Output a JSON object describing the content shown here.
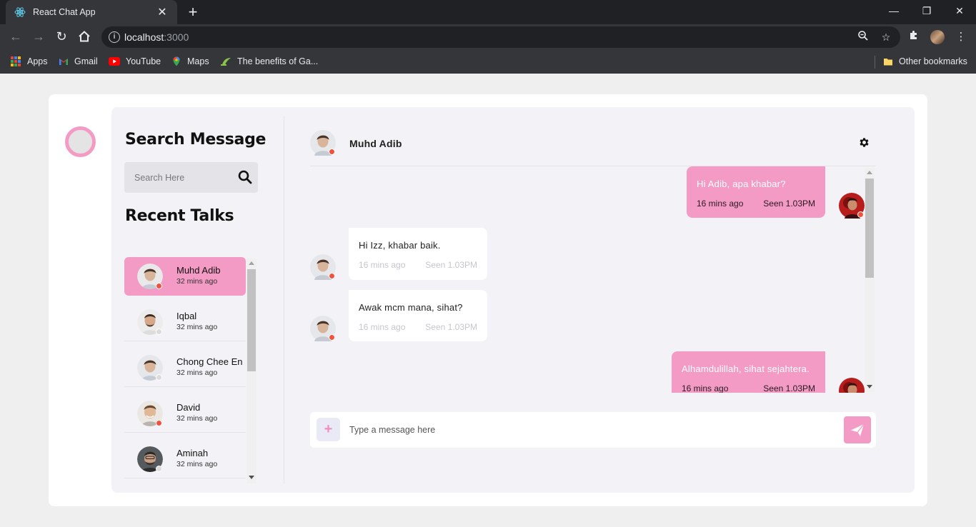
{
  "browser": {
    "tab_title": "React Chat App",
    "url_host": "localhost",
    "url_port": ":3000",
    "bookmarks": [
      "Apps",
      "Gmail",
      "YouTube",
      "Maps",
      "The benefits of Ga..."
    ],
    "other_bookmarks": "Other bookmarks"
  },
  "sidebar": {
    "search_title": "Search Message",
    "search_placeholder": "Search Here",
    "recent_title": "Recent Talks",
    "contacts": [
      {
        "name": "Muhd Adib",
        "time": "32 mins ago",
        "status": "online",
        "active": true
      },
      {
        "name": "Iqbal",
        "time": "32 mins ago",
        "status": "offline",
        "active": false
      },
      {
        "name": "Chong Chee En",
        "time": "32 mins ago",
        "status": "offline",
        "active": false
      },
      {
        "name": "David",
        "time": "32 mins ago",
        "status": "online",
        "active": false
      },
      {
        "name": "Aminah",
        "time": "32 mins ago",
        "status": "offline",
        "active": false
      }
    ]
  },
  "chat": {
    "contact_name": "Muhd Adib",
    "messages": [
      {
        "text": "Hi Adib, apa khabar?",
        "time": "16 mins ago",
        "seen": "Seen 1.03PM",
        "mine": true
      },
      {
        "text": "Hi Izz, khabar baik.",
        "time": "16 mins ago",
        "seen": "Seen 1.03PM",
        "mine": false
      },
      {
        "text": "Awak mcm mana, sihat?",
        "time": "16 mins ago",
        "seen": "Seen 1.03PM",
        "mine": false
      },
      {
        "text": "Alhamdulillah, sihat sejahtera.",
        "time": "16 mins ago",
        "seen": "Seen 1.03PM",
        "mine": true
      }
    ],
    "input_placeholder": "Type a message here",
    "add_label": "+"
  },
  "colors": {
    "accent_pink": "#f39bc5",
    "status_online": "#f0533c",
    "status_offline": "#dcdcdc"
  }
}
